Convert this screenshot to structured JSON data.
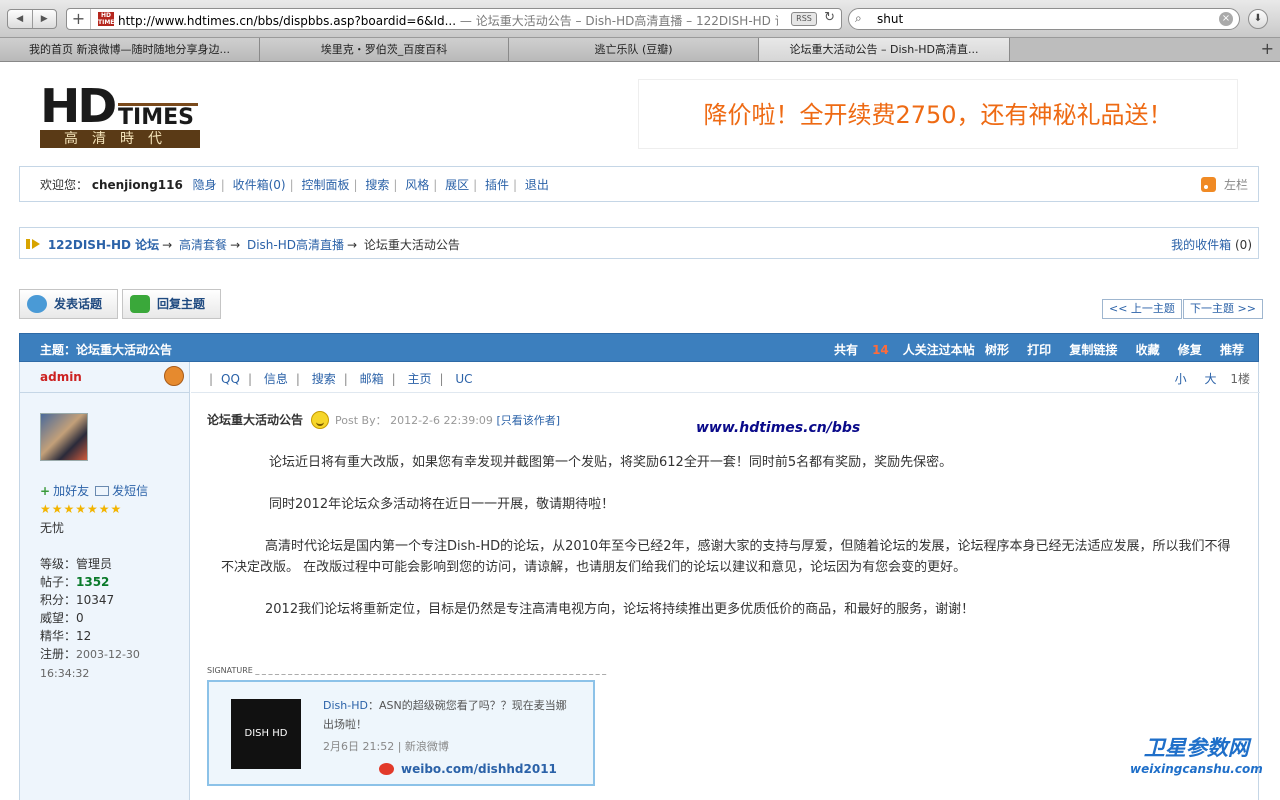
{
  "browser": {
    "url": "http://www.hdtimes.cn/bbs/dispbbs.asp?boardid=6&Id...",
    "title_suffix": "— 论坛重大活动公告 – Dish-HD高清直播 – 122DISH-HD 论...",
    "rss": "RSS",
    "search_value": "shut",
    "tabs": [
      "我的首页 新浪微博—随时随地分享身边...",
      "埃里克・罗伯茨_百度百科",
      "逃亡乐队 (豆瓣)",
      "论坛重大活动公告 – Dish-HD高清直..."
    ]
  },
  "site": {
    "logo_text": "HD",
    "logo_times": "TIMES",
    "logo_cn": "高清時代",
    "banner": "降价啦！全开续费2750，还有神秘礼品送！"
  },
  "userbar": {
    "welcome": "欢迎您：",
    "username": "chenjiong116",
    "links": [
      "隐身",
      "收件箱(0)",
      "控制面板",
      "搜索",
      "风格",
      "展区",
      "插件",
      "退出"
    ],
    "right": "左栏"
  },
  "breadcrumb": {
    "items": [
      "122DISH-HD 论坛",
      "高清套餐",
      "Dish-HD高清直播"
    ],
    "current": "论坛重大活动公告",
    "inbox": "我的收件箱",
    "inbox_count": "(0)"
  },
  "actions": {
    "new_topic": "发表话题",
    "reply": "回复主题",
    "prev": "<< 上一主题",
    "next": "下一主题 >>"
  },
  "topic": {
    "label": "主题：论坛重大活动公告",
    "follow_pre": "共有",
    "follow_count": "14",
    "follow_post": "人关注过本帖",
    "tools": [
      "树形",
      "打印",
      "复制链接",
      "收藏",
      "修复",
      "推荐"
    ]
  },
  "author": {
    "name": "admin",
    "add_friend": "加好友",
    "send_msg": "发短信",
    "stars": "★★★★★★★",
    "rank": "无忧",
    "stats": [
      {
        "k": "等级：",
        "v": "管理员"
      },
      {
        "k": "帖子：",
        "v": "1352"
      },
      {
        "k": "积分：",
        "v": "10347"
      },
      {
        "k": "威望：",
        "v": "0"
      },
      {
        "k": "精华：",
        "v": "12"
      },
      {
        "k": "注册：",
        "v": "2003-12-30 16:34:32"
      }
    ]
  },
  "contacts": {
    "items": [
      "QQ",
      "信息",
      "搜索",
      "邮箱",
      "主页",
      "UC"
    ],
    "small": "小",
    "big": "大",
    "floor": "1楼"
  },
  "post": {
    "title": "论坛重大活动公告",
    "meta_prefix": "Post By：",
    "date": "2012-2-6 22:39:09",
    "only_author": "[只看该作者]",
    "watermark": "www.hdtimes.cn/bbs",
    "paragraphs": [
      "论坛近日将有重大改版，如果您有幸发现并截图第一个发贴，将奖励612全开一套！同时前5名都有奖励，奖励先保密。",
      "同时2012年论坛众多活动将在近日一一开展，敬请期待啦！",
      "高清时代论坛是国内第一个专注Dish-HD的论坛，从2010年至今已经2年，感谢大家的支持与厚爱，但随着论坛的发展，论坛程序本身已经无法适应发展，所以我们不得不决定改版。 在改版过程中可能会影响到您的访问，请谅解，也请朋友们给我们的论坛以建议和意见，论坛因为有您会变的更好。",
      "2012我们论坛将重新定位，目标是仍然是专注高清电视方向，论坛将持续推出更多优质低价的商品，和最好的服务，谢谢！"
    ],
    "signature": "SIGNATURE _ _ _ _ _ _ _ _ _ _ _ _ _ _ _ _ _ _ _ _ _ _ _ _ _ _ _ _ _ _ _ _ _ _ _ _ _ _ _ _ _ _ _ _ _ _ _ _ _ _ _ _ _ _ _ _"
  },
  "weibo": {
    "logo": "DISH HD",
    "name": "Dish-HD",
    "text": "：ASN的超级碗您看了吗？？现在麦当娜出场啦！",
    "time": "2月6日 21:52 | 新浪微博",
    "url": "weibo.com/dishhd2011"
  },
  "corner": {
    "cn": "卫星参数网",
    "en": "weixingcanshu.com"
  }
}
